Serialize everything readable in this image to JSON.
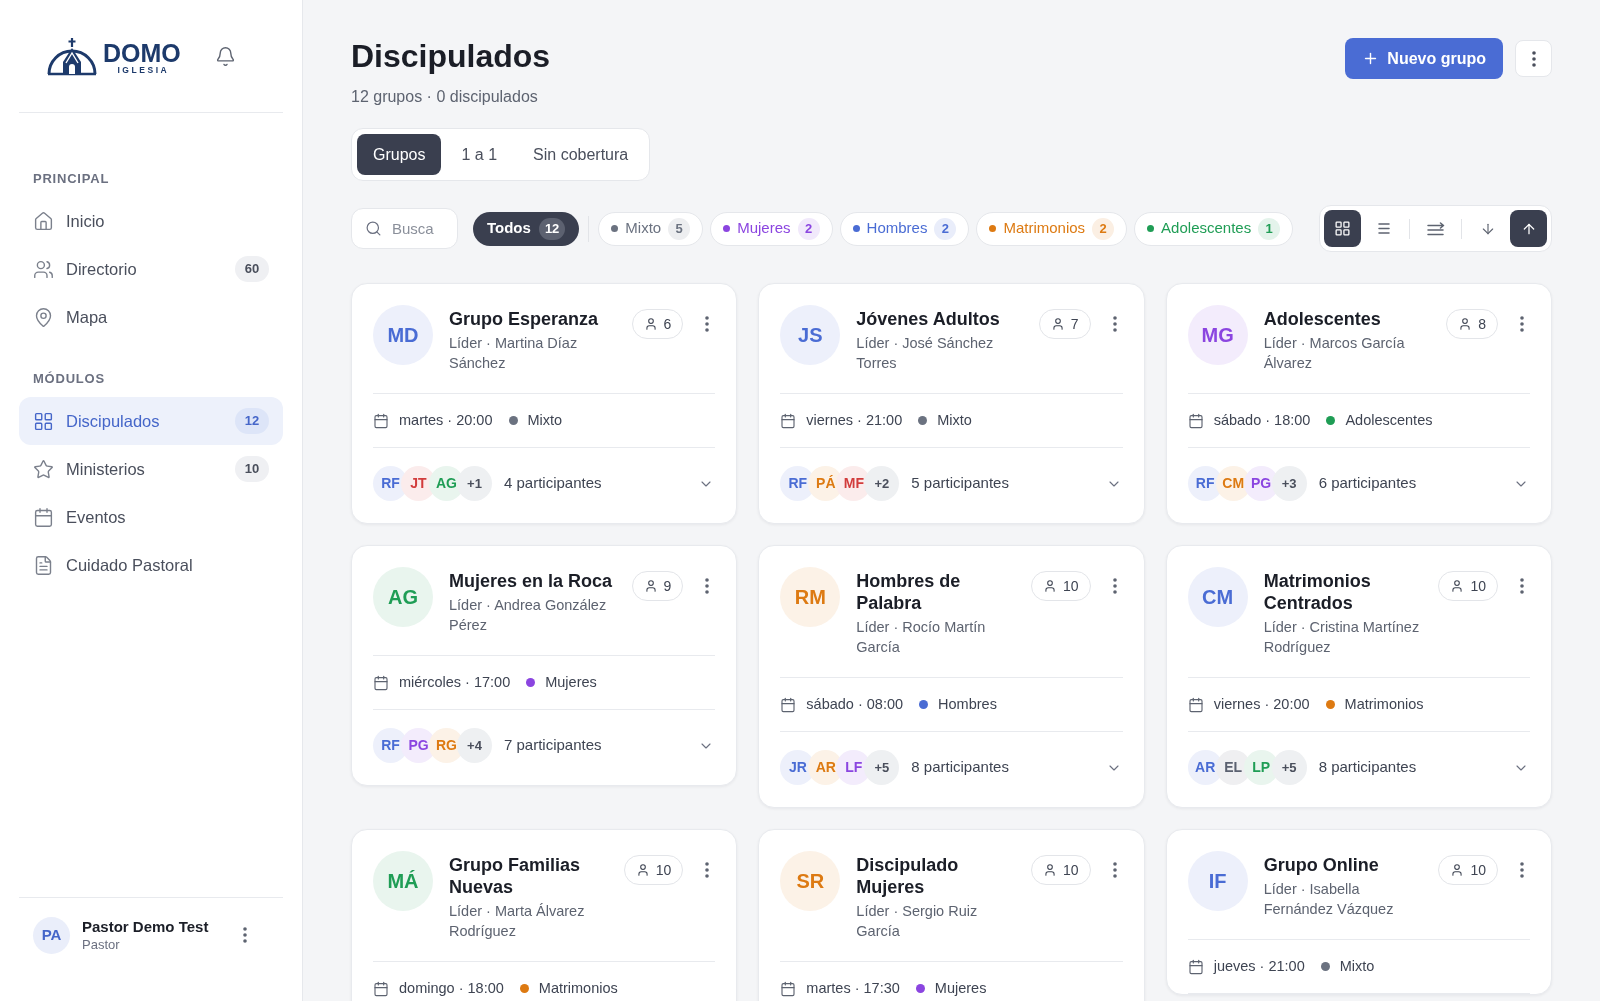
{
  "sidebar": {
    "logo": {
      "name": "DOMO",
      "tagline": "IGLESIA"
    },
    "sections": [
      {
        "title": "PRINCIPAL",
        "items": [
          {
            "kind": "home",
            "label": "Inicio",
            "selected": false
          },
          {
            "kind": "users",
            "label": "Directorio",
            "badge": "60",
            "selected": false
          },
          {
            "kind": "map",
            "label": "Mapa",
            "selected": false
          }
        ]
      },
      {
        "title": "MÓDULOS",
        "items": [
          {
            "kind": "grid",
            "label": "Discipulados",
            "badge": "12",
            "selected": true
          },
          {
            "kind": "star",
            "label": "Ministerios",
            "badge": "10",
            "selected": false
          },
          {
            "kind": "calendar",
            "label": "Eventos",
            "selected": false
          },
          {
            "kind": "document",
            "label": "Cuidado Pastoral",
            "selected": false
          }
        ]
      }
    ],
    "user": {
      "initials": "PA",
      "name": "Pastor Demo Test",
      "role": "Pastor"
    }
  },
  "header": {
    "title": "Discipulados",
    "subtitle": "12 grupos · 0 discipulados",
    "primary_button": "Nuevo grupo"
  },
  "tabs": [
    {
      "label": "Grupos",
      "selected": true
    },
    {
      "label": "1 a 1",
      "selected": false
    },
    {
      "label": "Sin cobertura",
      "selected": false
    }
  ],
  "search": {
    "placeholder": "Busca"
  },
  "filters": [
    {
      "label": "Todos",
      "count": "12",
      "selected": true
    },
    {
      "label": "Mixto",
      "count": "5",
      "color": "#6b7280",
      "selected": false
    },
    {
      "label": "Mujeres",
      "count": "2",
      "color": "#8b45e0",
      "selected": false
    },
    {
      "label": "Hombres",
      "count": "2",
      "color": "#4a6cd4",
      "selected": false
    },
    {
      "label": "Matrimonios",
      "count": "2",
      "color": "#dd7a12",
      "selected": false
    },
    {
      "label": "Adolescentes",
      "count": "1",
      "color": "#1f9d55",
      "selected": false
    }
  ],
  "view_modes": [
    {
      "kind": "grid",
      "selected": true
    },
    {
      "kind": "list",
      "selected": false
    }
  ],
  "sort_direction": [
    {
      "kind": "descending",
      "selected": false
    },
    {
      "kind": "ascending",
      "selected": true
    }
  ],
  "groups": [
    {
      "initials": "MD",
      "color": "#4a6cd4",
      "name": "Grupo Esperanza",
      "leader": "Líder · Martina Díaz Sánchez",
      "members": "6",
      "schedule": "martes · 20:00",
      "category": {
        "label": "Mixto",
        "color": "#6b7280"
      },
      "participants": {
        "avatars": [
          {
            "initials": "RF",
            "color": "#4a6cd4"
          },
          {
            "initials": "JT",
            "color": "#d23c3c"
          },
          {
            "initials": "AG",
            "color": "#1f9d55"
          }
        ],
        "more": "+1",
        "count": "4 participantes"
      }
    },
    {
      "initials": "JS",
      "color": "#4a6cd4",
      "name": "Jóvenes Adultos",
      "leader": "Líder · José Sánchez Torres",
      "members": "7",
      "schedule": "viernes · 21:00",
      "category": {
        "label": "Mixto",
        "color": "#6b7280"
      },
      "participants": {
        "avatars": [
          {
            "initials": "RF",
            "color": "#4a6cd4"
          },
          {
            "initials": "PÁ",
            "color": "#dd7a12"
          },
          {
            "initials": "MF",
            "color": "#d23c3c"
          }
        ],
        "more": "+2",
        "count": "5 participantes"
      }
    },
    {
      "initials": "MG",
      "color": "#8b45e0",
      "name": "Adolescentes",
      "leader": "Líder · Marcos García Álvarez",
      "members": "8",
      "schedule": "sábado · 18:00",
      "category": {
        "label": "Adolescentes",
        "color": "#1f9d55"
      },
      "participants": {
        "avatars": [
          {
            "initials": "RF",
            "color": "#4a6cd4"
          },
          {
            "initials": "CM",
            "color": "#dd7a12"
          },
          {
            "initials": "PG",
            "color": "#8b45e0"
          }
        ],
        "more": "+3",
        "count": "6 participantes"
      }
    },
    {
      "initials": "AG",
      "color": "#1f9d55",
      "name": "Mujeres en la Roca",
      "leader": "Líder · Andrea González Pérez",
      "members": "9",
      "schedule": "miércoles · 17:00",
      "category": {
        "label": "Mujeres",
        "color": "#8b45e0"
      },
      "participants": {
        "avatars": [
          {
            "initials": "RF",
            "color": "#4a6cd4"
          },
          {
            "initials": "PG",
            "color": "#8b45e0"
          },
          {
            "initials": "RG",
            "color": "#dd7a12"
          }
        ],
        "more": "+4",
        "count": "7 participantes"
      }
    },
    {
      "initials": "RM",
      "color": "#dd7a12",
      "name": "Hombres de Palabra",
      "leader": "Líder · Rocío Martín García",
      "members": "10",
      "schedule": "sábado · 08:00",
      "category": {
        "label": "Hombres",
        "color": "#4a6cd4"
      },
      "participants": {
        "avatars": [
          {
            "initials": "JR",
            "color": "#4a6cd4"
          },
          {
            "initials": "AR",
            "color": "#dd7a12"
          },
          {
            "initials": "LF",
            "color": "#8b45e0"
          }
        ],
        "more": "+5",
        "count": "8 participantes"
      }
    },
    {
      "initials": "CM",
      "color": "#4a6cd4",
      "name": "Matrimonios Centrados",
      "leader": "Líder · Cristina Martínez Rodríguez",
      "members": "10",
      "schedule": "viernes · 20:00",
      "category": {
        "label": "Matrimonios",
        "color": "#dd7a12"
      },
      "participants": {
        "avatars": [
          {
            "initials": "AR",
            "color": "#4a6cd4"
          },
          {
            "initials": "EL",
            "color": "#5b6170"
          },
          {
            "initials": "LP",
            "color": "#1f9d55"
          }
        ],
        "more": "+5",
        "count": "8 participantes"
      }
    },
    {
      "initials": "MÁ",
      "color": "#1f9d55",
      "name": "Grupo Familias Nuevas",
      "leader": "Líder · Marta Álvarez Rodríguez",
      "members": "10",
      "schedule": "domingo · 18:00",
      "category": {
        "label": "Matrimonios",
        "color": "#dd7a12"
      }
    },
    {
      "initials": "SR",
      "color": "#dd7a12",
      "name": "Discipulado Mujeres",
      "leader": "Líder · Sergio Ruiz García",
      "members": "10",
      "schedule": "martes · 17:30",
      "category": {
        "label": "Mujeres",
        "color": "#8b45e0"
      }
    },
    {
      "initials": "IF",
      "color": "#4a6cd4",
      "name": "Grupo Online",
      "leader": "Líder · Isabella Fernández Vázquez",
      "members": "10",
      "schedule": "jueves · 21:00",
      "category": {
        "label": "Mixto",
        "color": "#6b7280"
      }
    }
  ]
}
